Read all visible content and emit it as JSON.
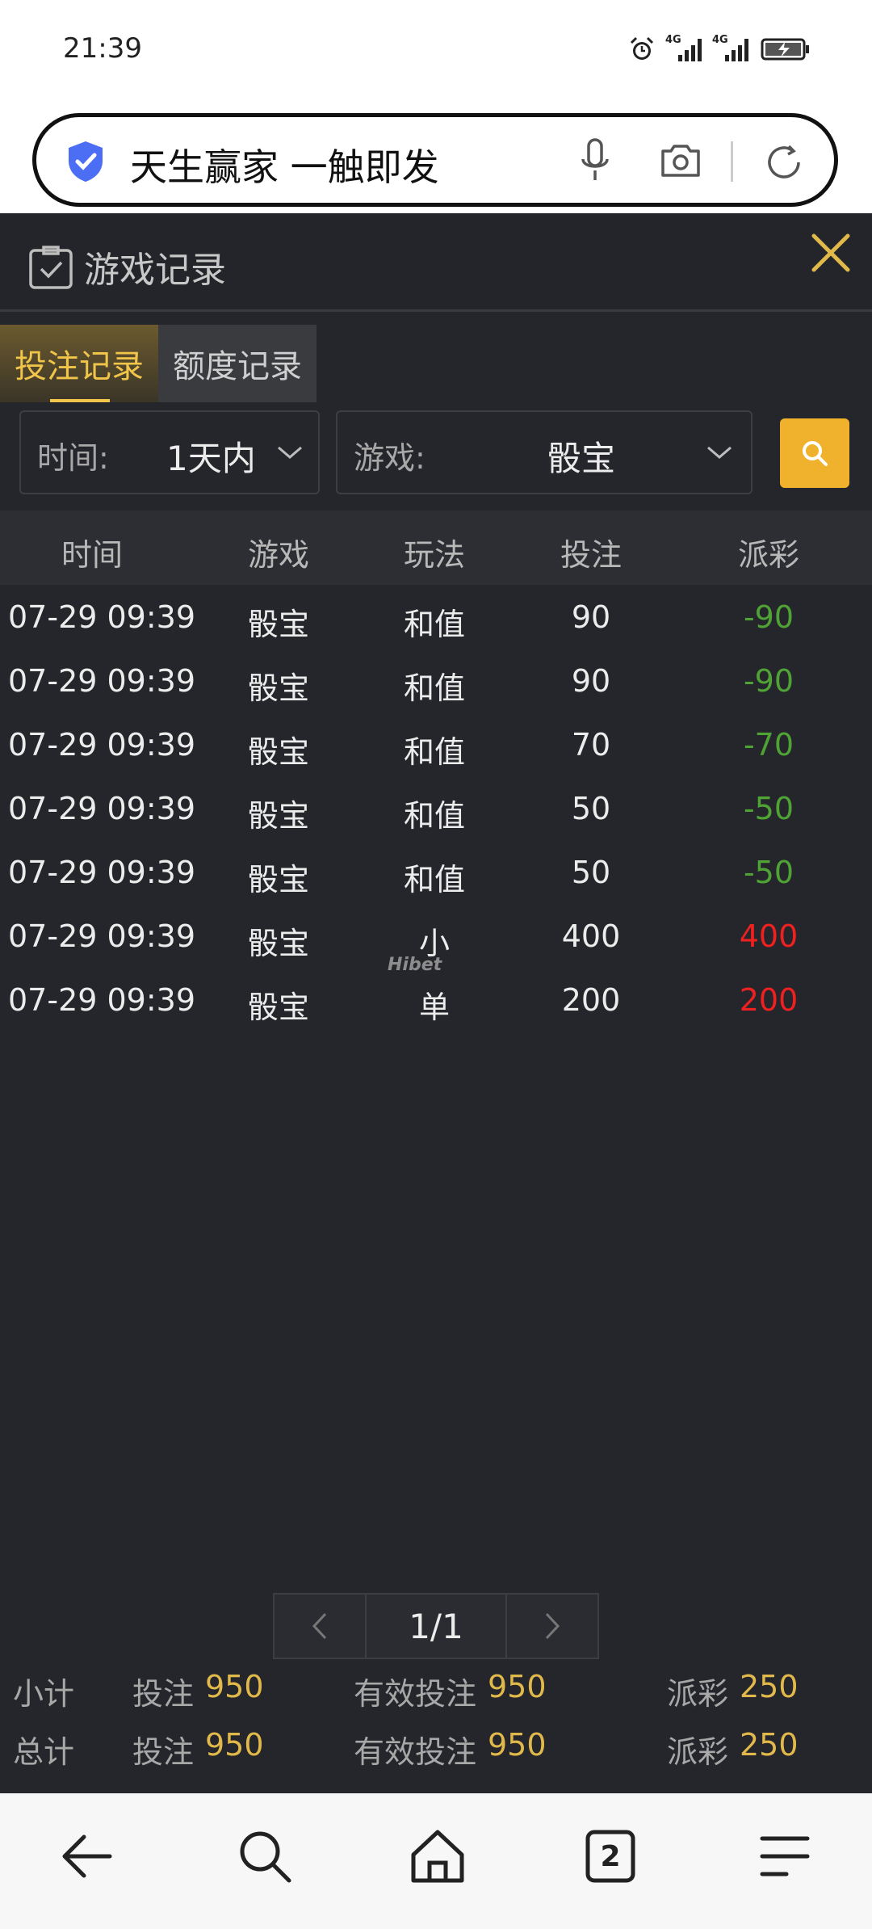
{
  "status_bar": {
    "time": "21:39",
    "signal1_label": "4G",
    "signal2_label": "4G"
  },
  "browser": {
    "url_text": "天生赢家 一触即发"
  },
  "panel": {
    "title": "游戏记录"
  },
  "tabs": [
    {
      "label": "投注记录",
      "active": true
    },
    {
      "label": "额度记录",
      "active": false
    }
  ],
  "filters": {
    "time_label": "时间:",
    "time_value": "1天内",
    "game_label": "游戏:",
    "game_value": "骰宝"
  },
  "table": {
    "headers": [
      "时间",
      "游戏",
      "玩法",
      "投注",
      "派彩"
    ],
    "rows": [
      {
        "time": "07-29 09:39",
        "game": "骰宝",
        "play": "和值",
        "bet": "90",
        "payout": "-90"
      },
      {
        "time": "07-29 09:39",
        "game": "骰宝",
        "play": "和值",
        "bet": "90",
        "payout": "-90"
      },
      {
        "time": "07-29 09:39",
        "game": "骰宝",
        "play": "和值",
        "bet": "70",
        "payout": "-70"
      },
      {
        "time": "07-29 09:39",
        "game": "骰宝",
        "play": "和值",
        "bet": "50",
        "payout": "-50"
      },
      {
        "time": "07-29 09:39",
        "game": "骰宝",
        "play": "和值",
        "bet": "50",
        "payout": "-50"
      },
      {
        "time": "07-29 09:39",
        "game": "骰宝",
        "play": "小",
        "bet": "400",
        "payout": "400"
      },
      {
        "time": "07-29 09:39",
        "game": "骰宝",
        "play": "单",
        "bet": "200",
        "payout": "200"
      }
    ],
    "watermark": "Hibet"
  },
  "pagination": {
    "page": "1/1"
  },
  "summary": {
    "subtotal": {
      "label": "小计",
      "bet_label": "投注",
      "bet": "950",
      "valid_label": "有效投注",
      "valid": "950",
      "payout_label": "派彩",
      "payout": "250"
    },
    "total": {
      "label": "总计",
      "bet_label": "投注",
      "bet": "950",
      "valid_label": "有效投注",
      "valid": "950",
      "payout_label": "派彩",
      "payout": "250"
    }
  },
  "bottom_nav": {
    "tab_count": "2"
  },
  "colors": {
    "accent": "#f0c54a",
    "search_button": "#f0b22c",
    "negative": "#4fa335",
    "positive": "#ef2020"
  }
}
